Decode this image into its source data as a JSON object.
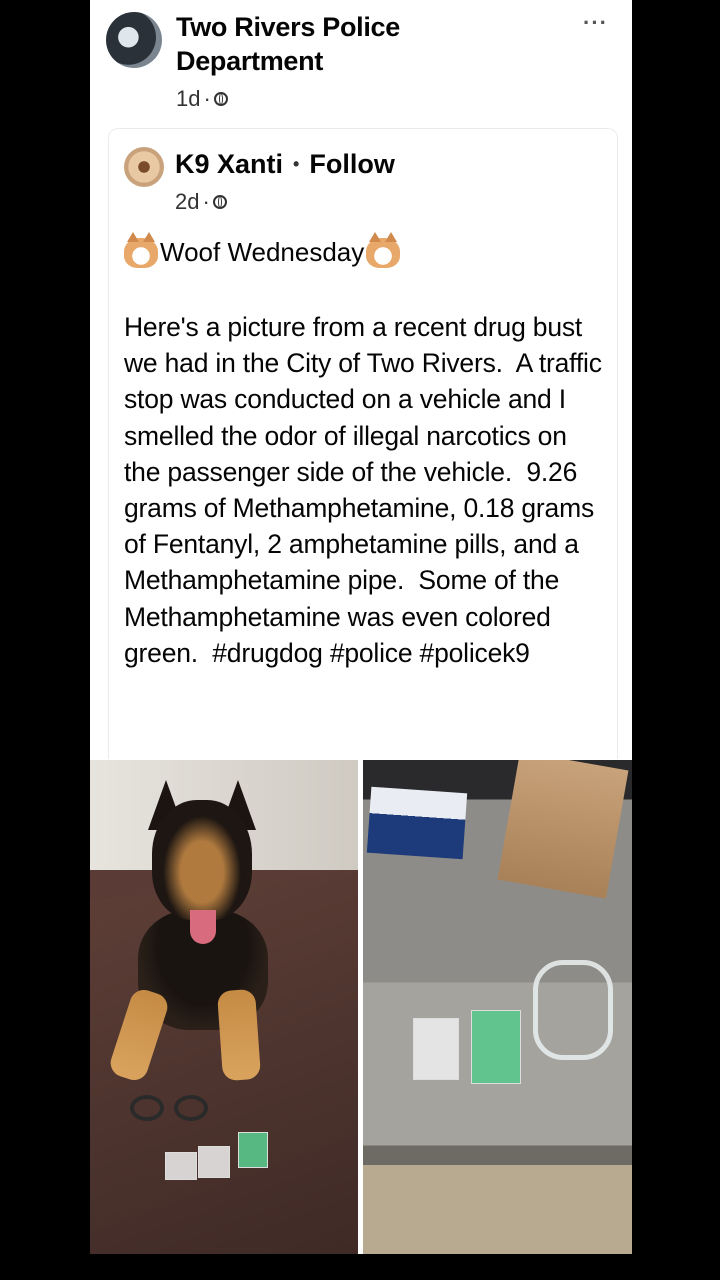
{
  "post": {
    "page_name": "Two Rivers Police Department",
    "time": "1d",
    "separator": "·",
    "more_label": "···"
  },
  "shared_post": {
    "author": "K9 Xanti",
    "dot": "•",
    "follow_label": "Follow",
    "time": "2d",
    "separator": "·",
    "headline": "Woof Wednesday",
    "body": "Here's a picture from a recent drug bust we had in the City of Two Rivers.  A traffic stop was conducted on a vehicle and I smelled the odor of illegal narcotics on the passenger side of the vehicle.  9.26 grams of Methamphetamine, 0.18 grams of Fentanyl, 2 amphetamine pills, and a Methamphetamine pipe.  Some of the Methamphetamine was even colored green.  #drugdog #police #policek9"
  },
  "icons": {
    "globe": "globe-icon",
    "more": "more-icon",
    "dog_face": "dog-face-icon"
  }
}
